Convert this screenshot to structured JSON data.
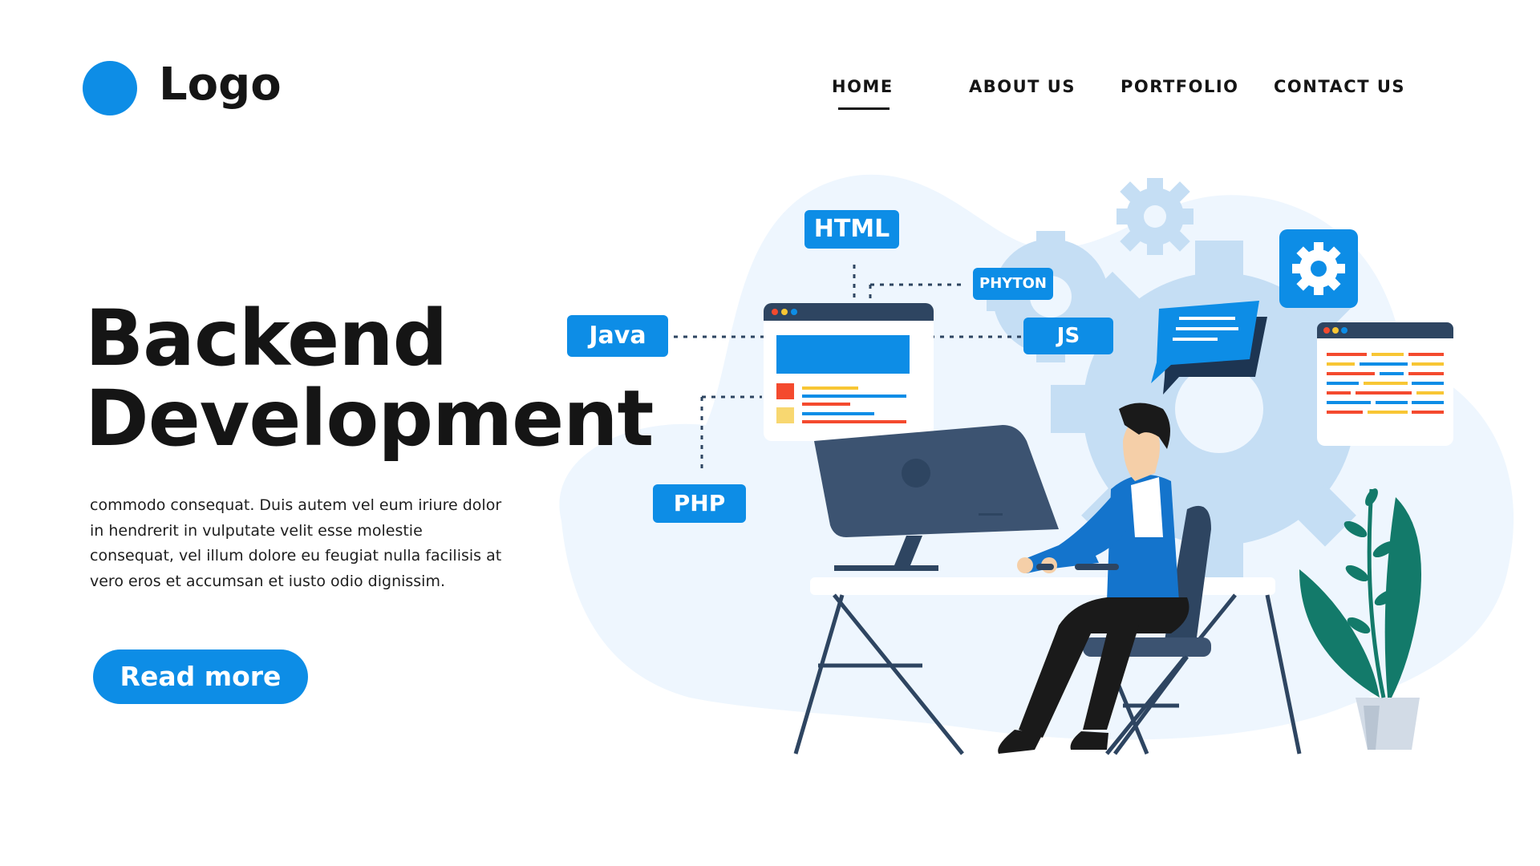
{
  "header": {
    "logo_text": "Logo",
    "nav": {
      "home": "HOME",
      "about": "ABOUT US",
      "portfolio": "PORTFOLIO",
      "contact": "CONTACT US"
    }
  },
  "hero": {
    "title_line1": "Backend",
    "title_line2": "Development",
    "body": "commodo consequat. Duis autem vel eum iriure dolor in hendrerit in vulputate velit esse molestie consequat, vel illum dolore eu feugiat nulla facilisis at vero eros et accumsan et iusto odio dignissim.",
    "cta_label": "Read more"
  },
  "illustration": {
    "tags": {
      "html": "HTML",
      "phyton": "PHYTON",
      "java": "Java",
      "js": "JS",
      "php": "PHP"
    }
  },
  "colors": {
    "accent": "#0d8de6",
    "text": "#151515",
    "blob": "#eef6fe",
    "gear": "#c5def4",
    "navy": "#2e4561"
  },
  "icons": [
    "logo-circle",
    "gear-icon",
    "chat-bubble-icon",
    "browser-window-icon",
    "monitor-icon",
    "plant-icon"
  ]
}
